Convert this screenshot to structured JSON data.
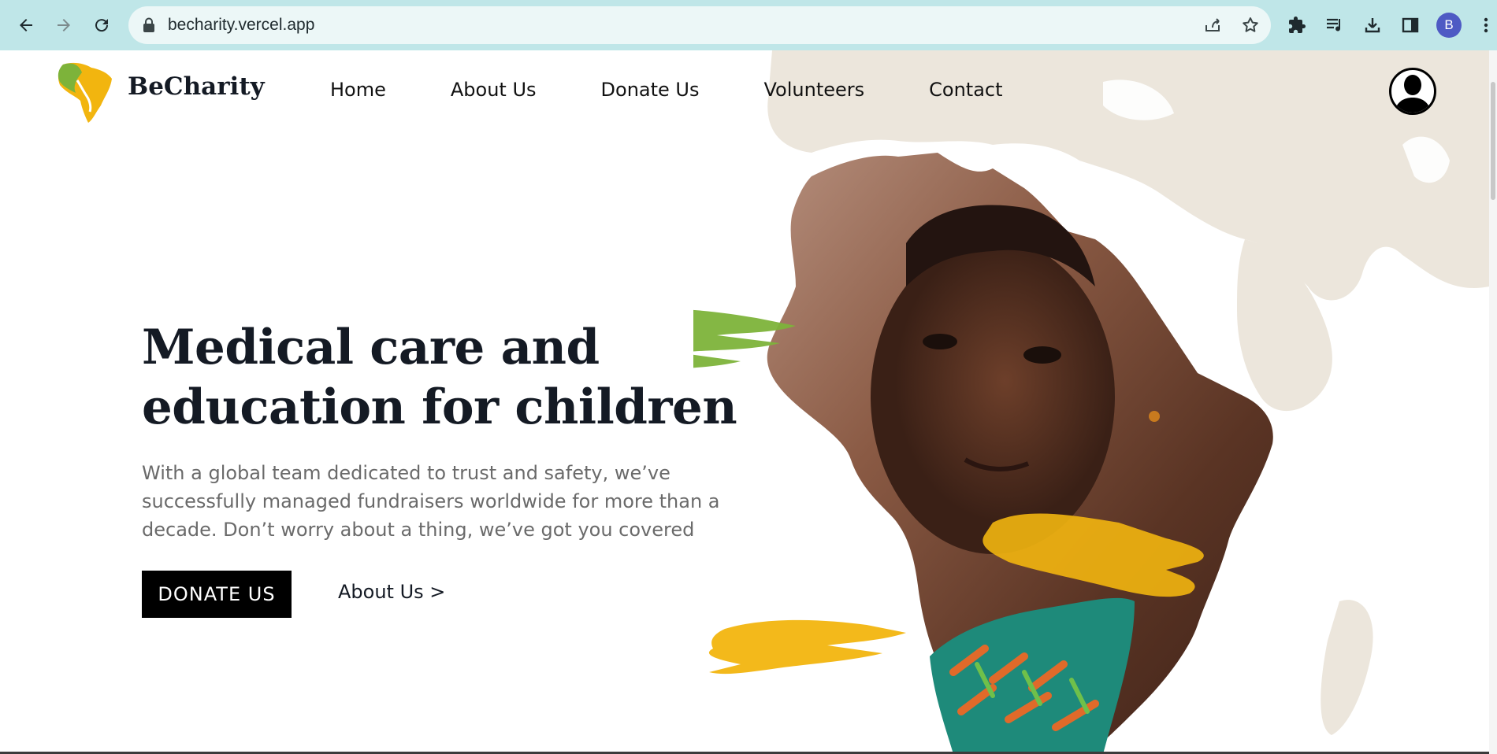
{
  "browser": {
    "url": "becharity.vercel.app",
    "profile_initial": "B",
    "icons": [
      "back-icon",
      "forward-icon",
      "reload-icon",
      "lock-icon",
      "share-icon",
      "bookmark-star-icon",
      "extensions-icon",
      "media-control-icon",
      "download-icon",
      "side-panel-icon",
      "menu-dots-icon"
    ]
  },
  "site": {
    "brand": "BeCharity",
    "nav": [
      "Home",
      "About Us",
      "Donate Us",
      "Volunteers",
      "Contact"
    ]
  },
  "hero": {
    "headline_line1": "Medical care and",
    "headline_line2": "education for children",
    "subtext": "With a global team dedicated to trust and safety, we’ve successfully managed fundraisers worldwide for more than a decade. Don’t worry about a thing, we’ve got you covered",
    "primary_button": "DONATE US",
    "secondary_link": "About Us >"
  },
  "colors": {
    "chrome_bg": "#bfe6e8",
    "brand_green": "#7db33a",
    "brand_yellow": "#f2b50f",
    "map_beige": "#ece6dc",
    "text_dark": "#141a24"
  }
}
